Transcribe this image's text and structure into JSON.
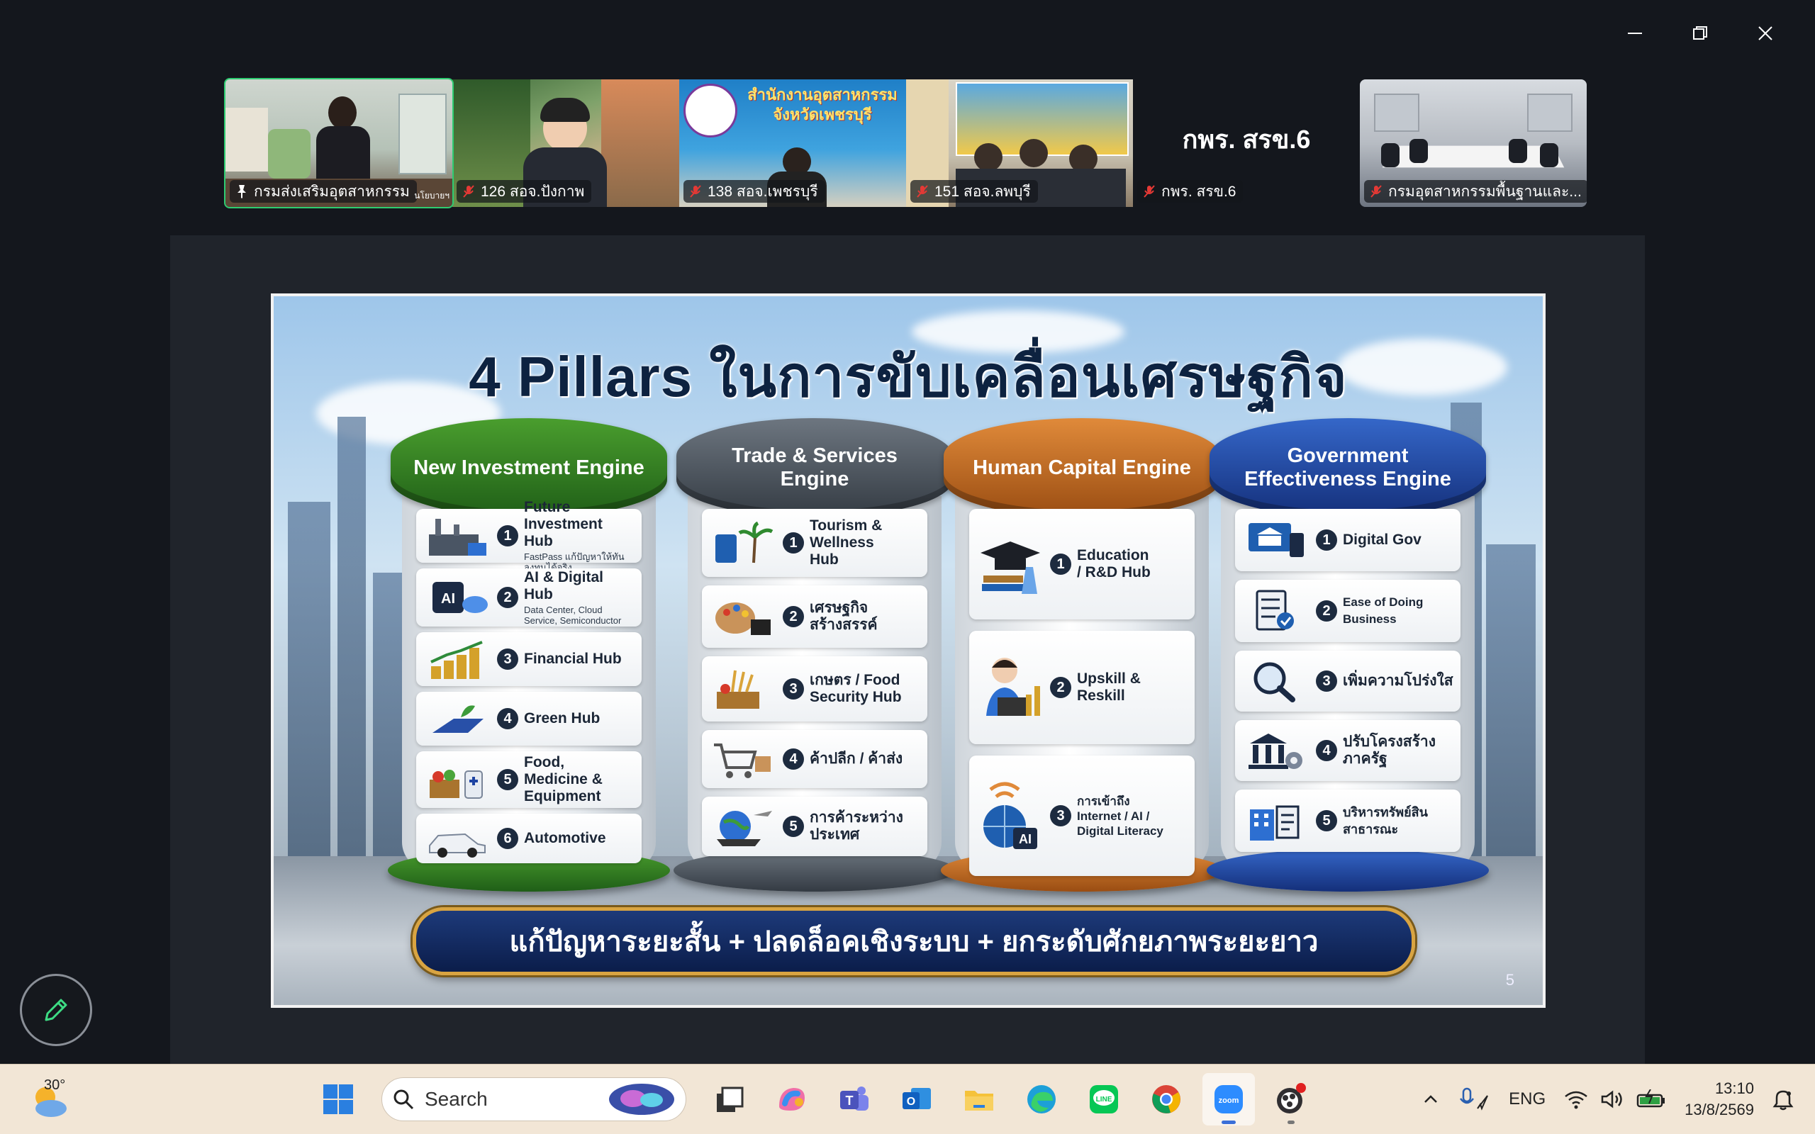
{
  "window": {
    "controls": [
      "minimize",
      "restore",
      "close"
    ]
  },
  "participants": [
    {
      "name": "กรมส่งเสริมอุตสาหกรรม",
      "pinned": true,
      "muted": false,
      "active": true,
      "sign": "นโยบายฯ"
    },
    {
      "name": "126 สอจ.ปังกาพ",
      "muted": true
    },
    {
      "name": "138 สอจ.เพชรบุรี",
      "muted": true,
      "sign_line1": "สำนักงานอุตสาหกรรม",
      "sign_line2": "จังหวัดเพชรบุรี"
    },
    {
      "name": "151 สอจ.ลพบุรี",
      "muted": true
    },
    {
      "name": "กพร. สรข.6",
      "muted": true,
      "video_off": true,
      "display": "กพร. สรข.6"
    },
    {
      "name": "กรมอุตสาหกรรมพื้นฐานและ...",
      "muted": true
    }
  ],
  "slide": {
    "title": "4 Pillars ในการขับเคลื่อนเศรษฐกิจ",
    "pillars": [
      {
        "header": "New Investment Engine",
        "items": [
          {
            "num": "1",
            "title": "Future Investment Hub",
            "sub": "FastPass แก้ปัญหาให้ทัน ลงทุนได้จริง"
          },
          {
            "num": "2",
            "title": "AI & Digital Hub",
            "sub": "Data Center, Cloud Service, Semiconductor"
          },
          {
            "num": "3",
            "title": "Financial Hub",
            "sub": ""
          },
          {
            "num": "4",
            "title": "Green Hub",
            "sub": ""
          },
          {
            "num": "5",
            "title": "Food, Medicine & Equipment",
            "sub": ""
          },
          {
            "num": "6",
            "title": "Automotive",
            "sub": ""
          }
        ]
      },
      {
        "header": "Trade & Services Engine",
        "items": [
          {
            "num": "1",
            "title": "Tourism & Wellness Hub",
            "sub": ""
          },
          {
            "num": "2",
            "title": "เศรษฐกิจสร้างสรรค์",
            "sub": ""
          },
          {
            "num": "3",
            "title": "เกษตร / Food Security Hub",
            "sub": ""
          },
          {
            "num": "4",
            "title": "ค้าปลีก / ค้าส่ง",
            "sub": ""
          },
          {
            "num": "5",
            "title": "การค้าระหว่างประเทศ",
            "sub": ""
          }
        ]
      },
      {
        "header": "Human Capital Engine",
        "items": [
          {
            "num": "1",
            "title": "Education / R&D Hub",
            "sub": ""
          },
          {
            "num": "2",
            "title": "Upskill & Reskill",
            "sub": ""
          },
          {
            "num": "3",
            "title": "การเข้าถึง Internet / AI / Digital Literacy",
            "sub": ""
          }
        ]
      },
      {
        "header": "Government Effectiveness Engine",
        "items": [
          {
            "num": "1",
            "title": "Digital Gov",
            "sub": ""
          },
          {
            "num": "2",
            "title": "Ease of Doing Business",
            "sub": ""
          },
          {
            "num": "3",
            "title": "เพิ่มความโปร่งใส",
            "sub": ""
          },
          {
            "num": "4",
            "title": "ปรับโครงสร้างภาครัฐ",
            "sub": ""
          },
          {
            "num": "5",
            "title": "บริหารทรัพย์สินสาธารณะ",
            "sub": ""
          }
        ]
      }
    ],
    "banner": "แก้ปัญหาระยะสั้น  +  ปลดล็อคเชิงระบบ  +  ยกระดับศักยภาพระยะยาว",
    "page_number": "5",
    "icons": [
      "factory-icon",
      "ai-chip-icon",
      "coins-chart-icon",
      "solar-panel-icon",
      "food-medicine-icon",
      "car-icon",
      "luggage-palm-icon",
      "palette-icon",
      "wheat-icon",
      "cart-icon",
      "globe-ship-icon",
      "graduation-cap-icon",
      "student-laptop-icon",
      "globe-ai-icon",
      "gov-building-icon",
      "checklist-icon",
      "magnifier-icon",
      "gear-building-icon",
      "document-building-icon"
    ]
  },
  "taskbar": {
    "weather_temp": "30°",
    "search_placeholder": "Search",
    "apps": [
      "start",
      "search",
      "task-view",
      "copilot",
      "teams",
      "outlook",
      "file-explorer",
      "edge",
      "line",
      "chrome",
      "zoom",
      "obs"
    ],
    "language": "ENG",
    "time": "13:10",
    "date": "13/8/2569"
  },
  "colors": {
    "active_outline": "#2ecc71",
    "pillar_green": "#2f7a1f",
    "pillar_gray": "#4b535c",
    "pillar_orange": "#c06a22",
    "pillar_blue": "#1e44a3",
    "banner_gold": "#d9a441"
  }
}
